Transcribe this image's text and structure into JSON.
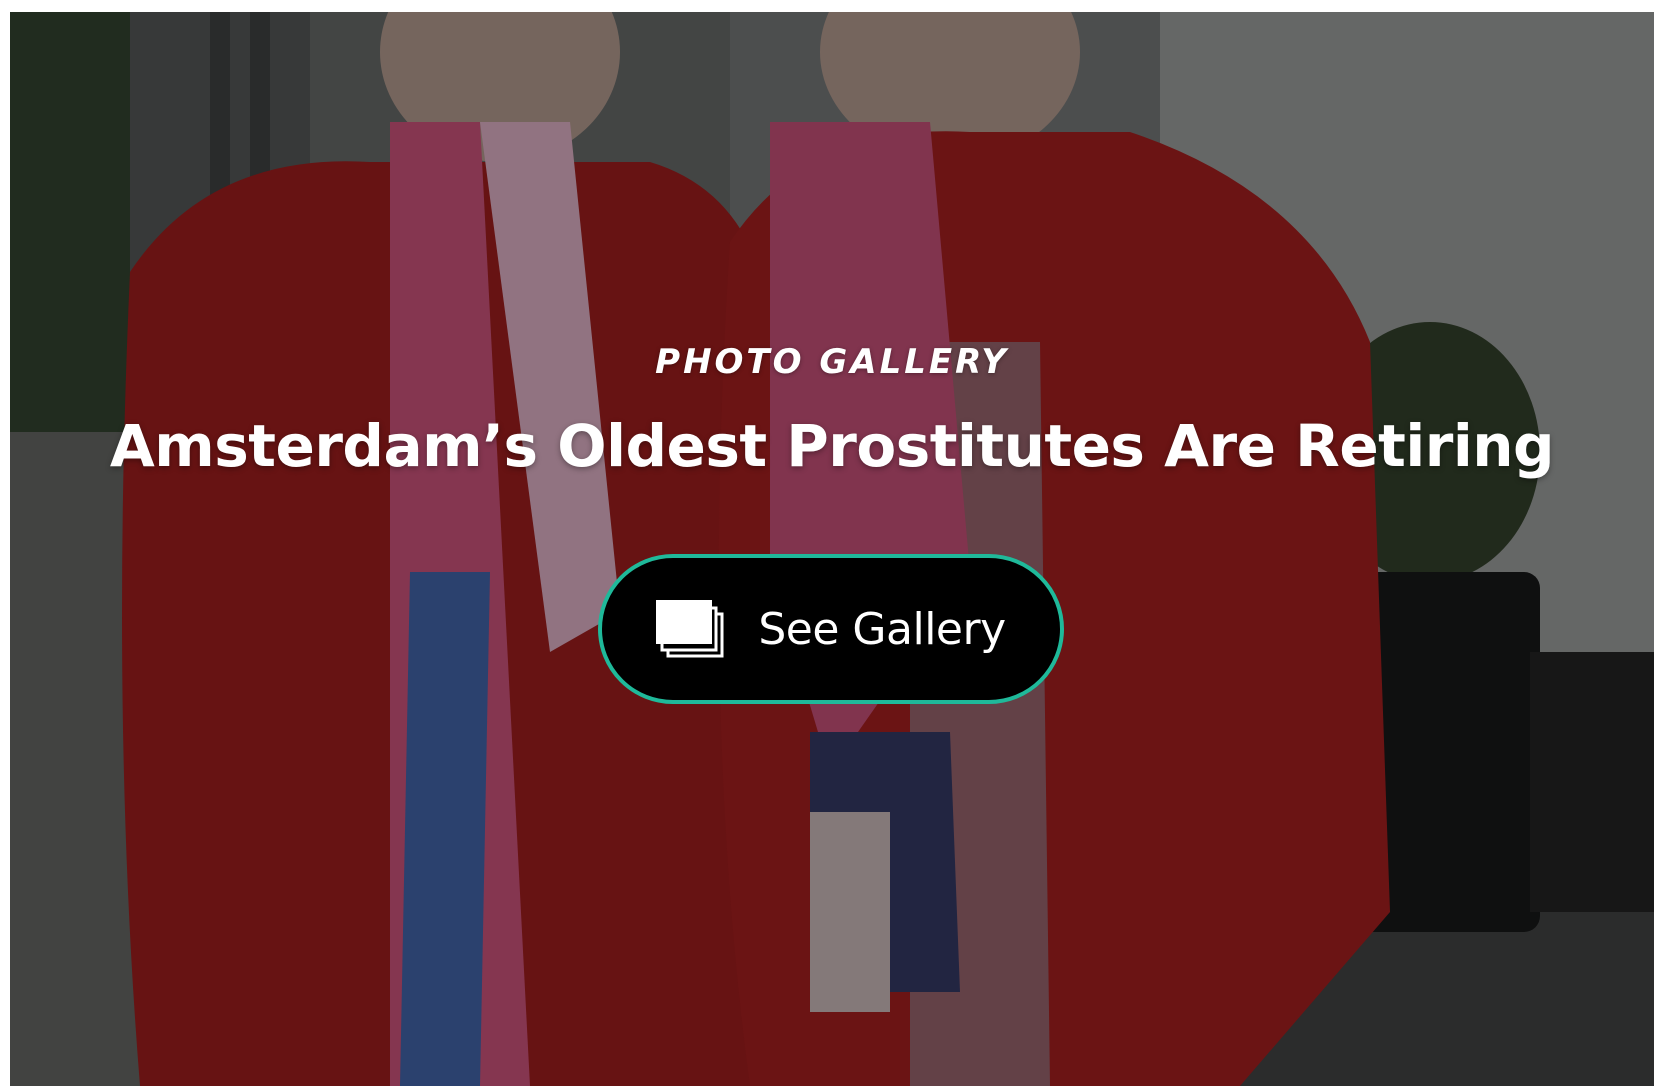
{
  "hero": {
    "kicker": "PHOTO GALLERY",
    "headline": "Amsterdam’s Oldest Prostitutes Are Retiring",
    "button_label": "See Gallery",
    "button_icon": "gallery-stack-icon"
  },
  "colors": {
    "button_border": "#1fb99a",
    "button_bg": "#000000",
    "text": "#ffffff",
    "coat_red": "#a81c1c"
  }
}
